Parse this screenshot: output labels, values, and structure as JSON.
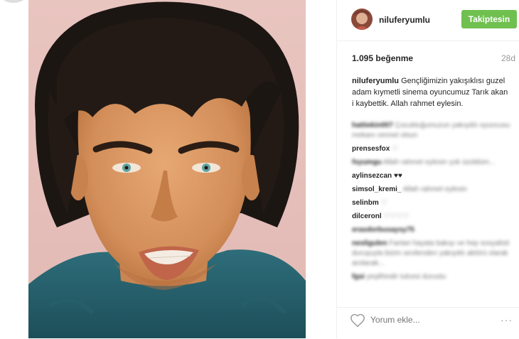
{
  "post": {
    "username": "niluferyumlu",
    "follow_label": "Takiptesin",
    "likes": "1.095 beğenme",
    "age": "28d",
    "caption_user": "niluferyumlu",
    "caption_text": "Gençliğimizin yakışıklısı guzel adam kıymetli sinema oyuncumuz Tarık akan i kaybettik. Allah rahmet eylesin."
  },
  "comments": [
    {
      "user": "hattiekin007",
      "text": "Çocukluğumuzun yakışıklı oyuncusu mekanı cennet olsun"
    },
    {
      "user": "prensesfox",
      "text": "♡"
    },
    {
      "user": "fsyumgu",
      "text": "Allah rahmet eylesin çok üzüldüm..."
    },
    {
      "user": "aylinsezcan",
      "text": "♥♥"
    },
    {
      "user": "simsol_kremi_",
      "text": "Allah rahmet eylesin"
    },
    {
      "user": "selinbm",
      "text": "♡"
    },
    {
      "user": "dilceronl",
      "text": "♡♡♡♡"
    },
    {
      "user": "erasdorbusaysy75",
      "text": ""
    },
    {
      "user": "nesligulen",
      "text": "Fanlari hayata bakışı ve hep sosyalisti duruşuyla bizim sevilenden yakışıklı aktörü olarak anılacak..."
    },
    {
      "user": "fgsi",
      "text": "yeşilhindir tulcesi durustu"
    }
  ],
  "footer": {
    "comment_placeholder": "Yorum ekle...",
    "more_icon": "···"
  },
  "colors": {
    "follow_green": "#70c050",
    "text": "#262626",
    "muted": "#999999"
  }
}
